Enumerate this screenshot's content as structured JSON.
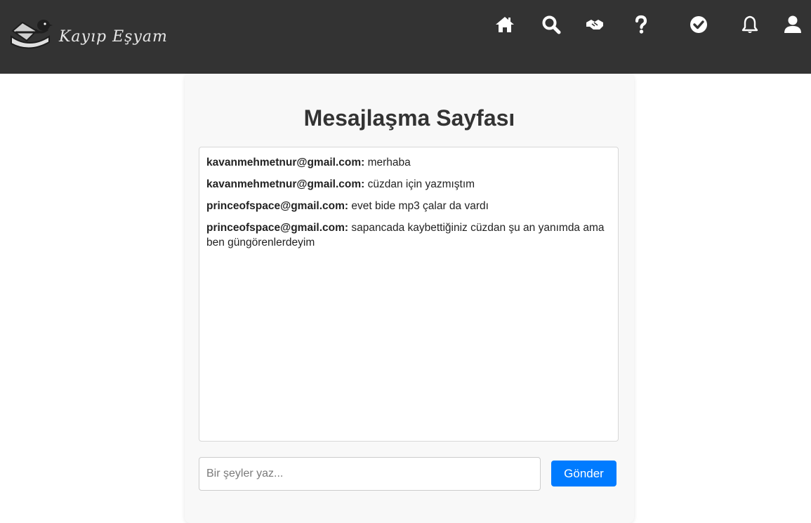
{
  "header": {
    "brand_name": "Kayıp Eşyam",
    "background_color": "#333333",
    "icon_color": "#ffffff",
    "nav_icons": [
      "home-icon",
      "search-icon",
      "handshake-icon",
      "help-icon",
      "check-circle-icon",
      "bell-icon",
      "user-icon"
    ]
  },
  "page": {
    "title": "Mesajlaşma Sayfası"
  },
  "messages": [
    {
      "sender": "kavanmehmetnur@gmail.com:",
      "text": "merhaba"
    },
    {
      "sender": "kavanmehmetnur@gmail.com:",
      "text": "cüzdan için yazmıştım"
    },
    {
      "sender": "princeofspace@gmail.com:",
      "text": "evet bide mp3 çalar da vardı"
    },
    {
      "sender": "princeofspace@gmail.com:",
      "text": "sapancada kaybettiğiniz cüzdan şu an yanımda ama ben güngörenlerdeyim"
    }
  ],
  "composer": {
    "placeholder": "Bir şeyler yaz...",
    "value": "",
    "send_label": "Gönder",
    "send_color": "#007bff"
  }
}
